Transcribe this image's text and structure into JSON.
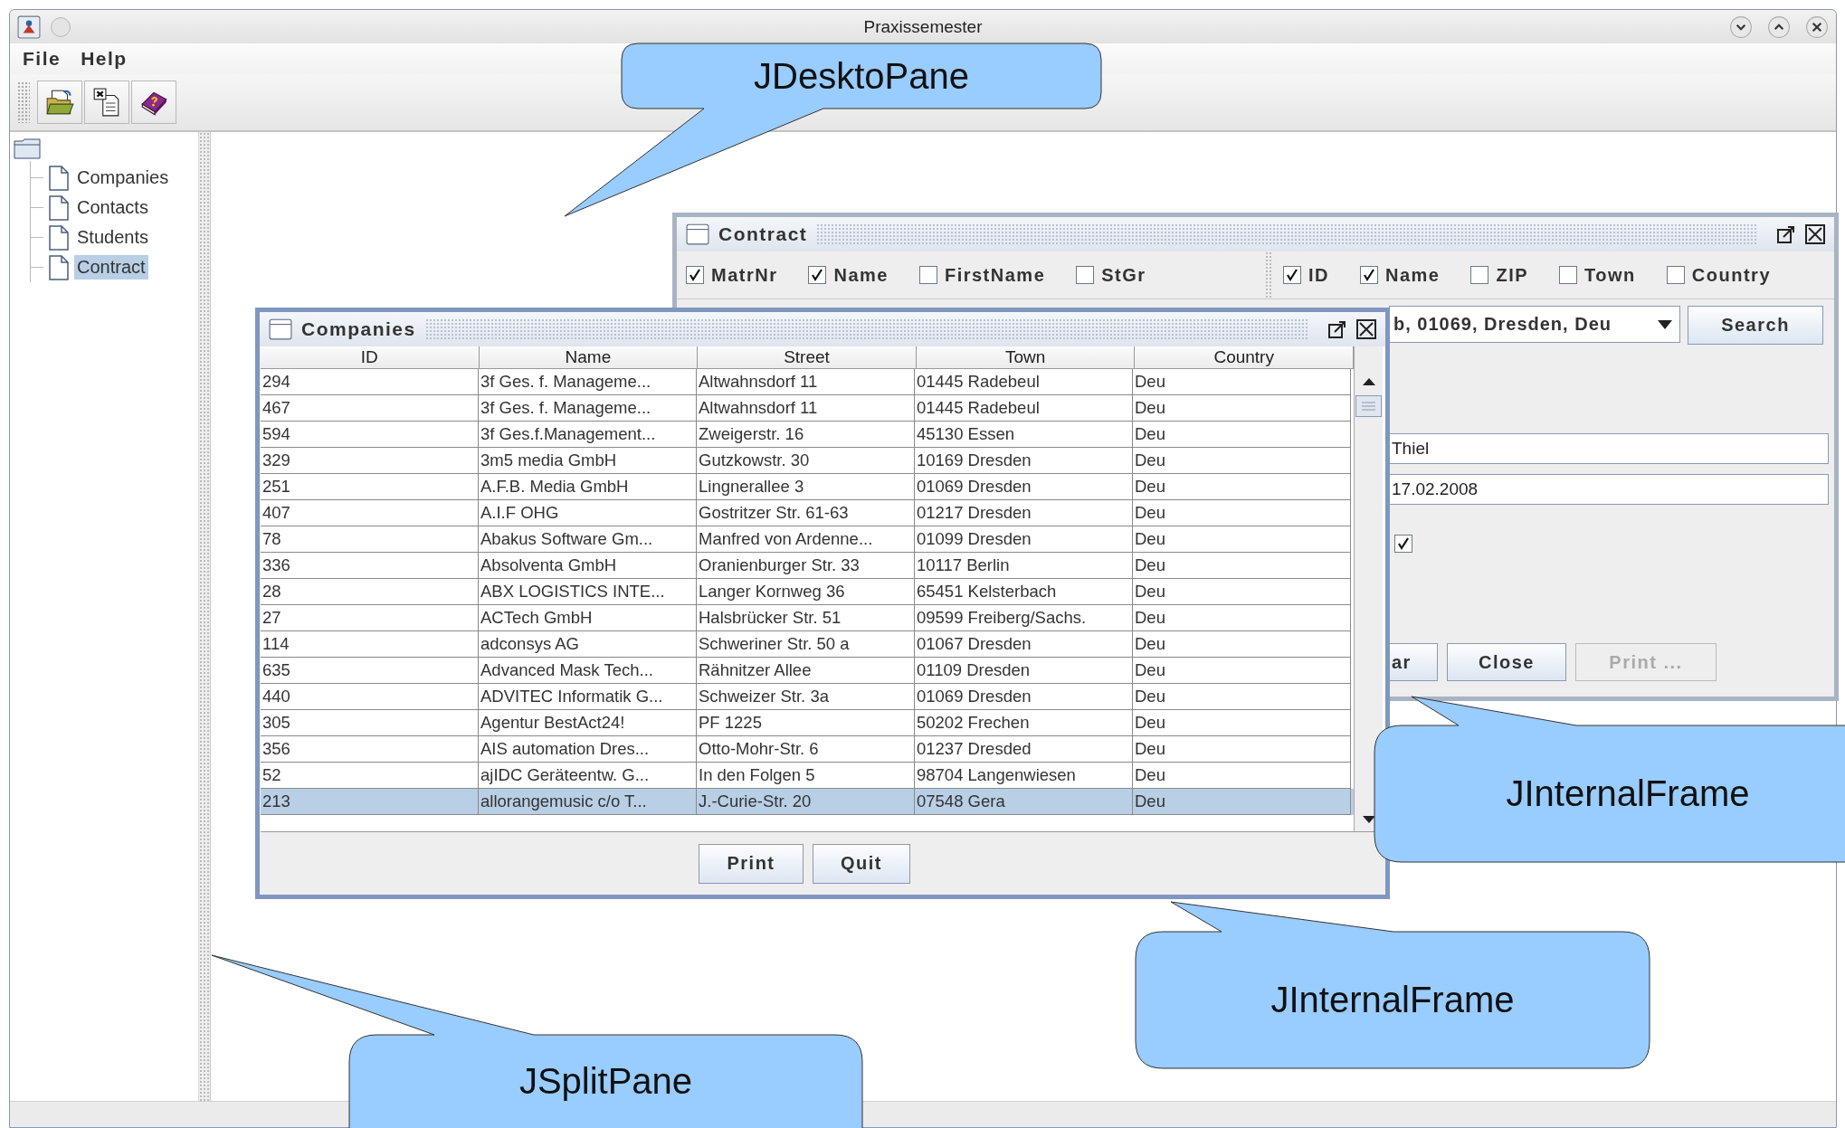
{
  "window": {
    "title": "Praxissemester"
  },
  "menu": [
    "File",
    "Help"
  ],
  "tree": {
    "items": [
      {
        "label": "Companies",
        "selected": false
      },
      {
        "label": "Contacts",
        "selected": false
      },
      {
        "label": "Students",
        "selected": false
      },
      {
        "label": "Contract",
        "selected": true
      }
    ]
  },
  "contract_frame": {
    "title": "Contract",
    "student_columns": [
      {
        "label": "MatrNr",
        "checked": true
      },
      {
        "label": "Name",
        "checked": true
      },
      {
        "label": "FirstName",
        "checked": false
      },
      {
        "label": "StGr",
        "checked": false
      }
    ],
    "company_columns": [
      {
        "label": "ID",
        "checked": true
      },
      {
        "label": "Name",
        "checked": true
      },
      {
        "label": "ZIP",
        "checked": false
      },
      {
        "label": "Town",
        "checked": false
      },
      {
        "label": "Country",
        "checked": false
      }
    ],
    "company_combo": {
      "value": "b, 01069, Dresden, Deu"
    },
    "search_button": "Search",
    "fields": [
      {
        "value": "Thiel"
      },
      {
        "value": "17.02.2008"
      }
    ],
    "option_checkbox": {
      "checked": true
    },
    "buttons": [
      {
        "label": "ar",
        "disabled": false
      },
      {
        "label": "Close",
        "disabled": false
      },
      {
        "label": "Print ...",
        "disabled": true
      }
    ]
  },
  "companies_frame": {
    "title": "Companies",
    "table": {
      "columns": [
        "ID",
        "Name",
        "Street",
        "Town",
        "Country"
      ],
      "rows": [
        {
          "id": "294",
          "name": "3f Ges. f. Manageme...",
          "street": "Altwahnsdorf 11",
          "town": "01445 Radebeul",
          "country": "Deu",
          "selected": false
        },
        {
          "id": "467",
          "name": "3f Ges. f. Manageme...",
          "street": "Altwahnsdorf 11",
          "town": "01445 Radebeul",
          "country": "Deu",
          "selected": false
        },
        {
          "id": "594",
          "name": "3f Ges.f.Management...",
          "street": "Zweigerstr. 16",
          "town": "45130 Essen",
          "country": "Deu",
          "selected": false
        },
        {
          "id": "329",
          "name": "3m5 media GmbH",
          "street": "Gutzkowstr. 30",
          "town": "10169 Dresden",
          "country": "Deu",
          "selected": false
        },
        {
          "id": "251",
          "name": "A.F.B. Media GmbH",
          "street": "Lingnerallee 3",
          "town": "01069 Dresden",
          "country": "Deu",
          "selected": false
        },
        {
          "id": "407",
          "name": "A.I.F OHG",
          "street": "Gostritzer Str. 61-63",
          "town": "01217 Dresden",
          "country": "Deu",
          "selected": false
        },
        {
          "id": "78",
          "name": "Abakus Software Gm...",
          "street": "Manfred von Ardenne...",
          "town": "01099 Dresden",
          "country": "Deu",
          "selected": false
        },
        {
          "id": "336",
          "name": "Absolventa GmbH",
          "street": "Oranienburger Str. 33",
          "town": "10117 Berlin",
          "country": "Deu",
          "selected": false
        },
        {
          "id": "28",
          "name": "ABX LOGISTICS INTE...",
          "street": "Langer Kornweg 36",
          "town": "65451 Kelsterbach",
          "country": "Deu",
          "selected": false
        },
        {
          "id": "27",
          "name": "ACTech GmbH",
          "street": "Halsbrücker Str. 51",
          "town": "09599 Freiberg/Sachs.",
          "country": "Deu",
          "selected": false
        },
        {
          "id": "114",
          "name": "adconsys AG",
          "street": "Schweriner Str. 50 a",
          "town": "01067 Dresden",
          "country": "Deu",
          "selected": false
        },
        {
          "id": "635",
          "name": "Advanced Mask Tech...",
          "street": "Rähnitzer Allee",
          "town": "01109 Dresden",
          "country": "Deu",
          "selected": false
        },
        {
          "id": "440",
          "name": "ADVITEC Informatik G...",
          "street": "Schweizer Str. 3a",
          "town": "01069 Dresden",
          "country": "Deu",
          "selected": false
        },
        {
          "id": "305",
          "name": "Agentur BestAct24!",
          "street": "PF 1225",
          "town": "50202 Frechen",
          "country": "Deu",
          "selected": false
        },
        {
          "id": "356",
          "name": "AIS automation Dres...",
          "street": "Otto-Mohr-Str. 6",
          "town": "01237 Dresded",
          "country": "Deu",
          "selected": false
        },
        {
          "id": "52",
          "name": "ajIDC  Geräteentw. G...",
          "street": "In den Folgen 5",
          "town": "98704 Langenwiesen",
          "country": "Deu",
          "selected": false
        },
        {
          "id": "213",
          "name": "allorangemusic c/o T...",
          "street": "J.-Curie-Str. 20",
          "town": "07548 Gera",
          "country": "Deu",
          "selected": true
        }
      ]
    },
    "buttons": [
      "Print",
      "Quit"
    ]
  },
  "callouts": [
    "JDesktoPane",
    "JInternalFrame",
    "JInternalFrame",
    "JSplitPane"
  ]
}
